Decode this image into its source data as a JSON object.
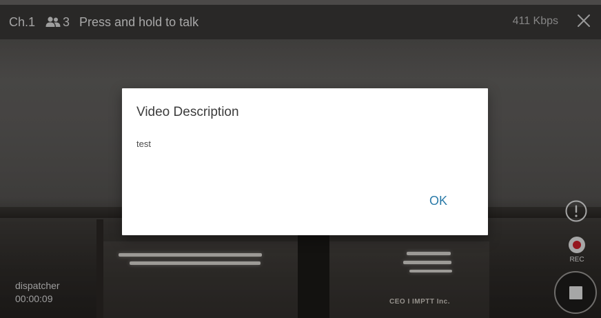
{
  "topbar": {
    "channel": "Ch.1",
    "users_icon": "users-icon",
    "users_count": "3",
    "ptt_hint": "Press and hold to talk",
    "bitrate": "411 Kbps",
    "close_icon": "close-icon"
  },
  "controls": {
    "alert_icon": "alert-icon",
    "rec_label": "REC",
    "stop_icon": "stop-icon",
    "rec_color": "#cf1f2a"
  },
  "caller": {
    "name": "dispatcher",
    "elapsed": "00:00:09"
  },
  "video": {
    "watermark": "CEO I IMPTT Inc."
  },
  "dialog": {
    "title": "Video Description",
    "body": "test",
    "ok_label": "OK",
    "accent": "#2a7aa8"
  }
}
